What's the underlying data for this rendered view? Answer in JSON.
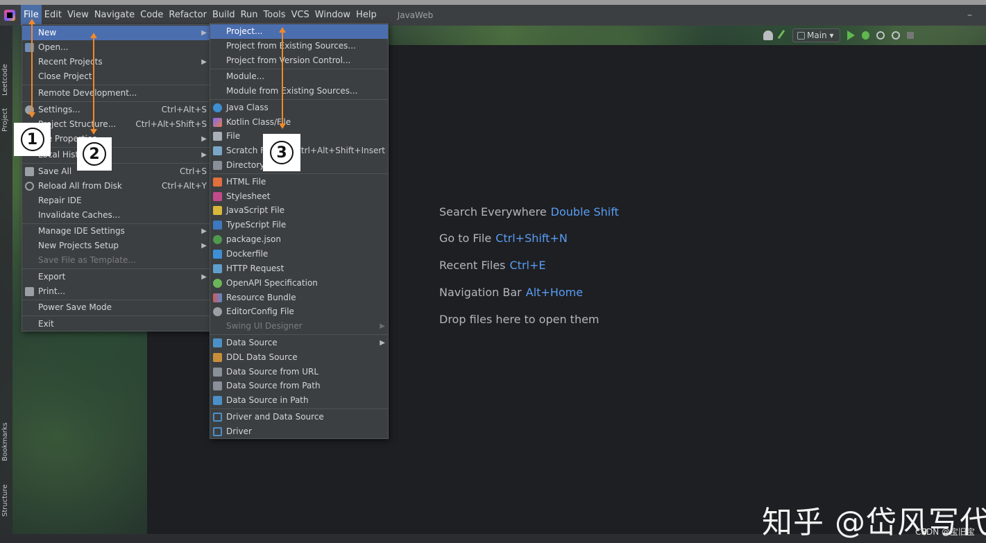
{
  "menubar": {
    "items": [
      "File",
      "Edit",
      "View",
      "Navigate",
      "Code",
      "Refactor",
      "Build",
      "Run",
      "Tools",
      "VCS",
      "Window",
      "Help"
    ],
    "active": "File",
    "title": "JavaWeb",
    "minimize": "–"
  },
  "toolbar": {
    "branch": "Main",
    "branch_caret": "▾"
  },
  "side_panels": [
    "Leetcode",
    "Project",
    "Bookmarks",
    "Structure"
  ],
  "file_menu": {
    "new": "New",
    "open": "Open...",
    "recent_projects": "Recent Projects",
    "close_project": "Close Project",
    "remote_development": "Remote Development...",
    "settings": "Settings...",
    "settings_shortcut": "Ctrl+Alt+S",
    "project_structure": "Project Structure...",
    "project_structure_shortcut": "Ctrl+Alt+Shift+S",
    "file_properties": "File Properties",
    "local_history": "Local History",
    "save_all": "Save All",
    "save_all_shortcut": "Ctrl+S",
    "reload": "Reload All from Disk",
    "reload_shortcut": "Ctrl+Alt+Y",
    "repair_ide": "Repair IDE",
    "invalidate_caches": "Invalidate Caches...",
    "manage_ide_settings": "Manage IDE Settings",
    "new_projects_setup": "New Projects Setup",
    "save_file_as_template": "Save File as Template...",
    "export": "Export",
    "print": "Print...",
    "power_save_mode": "Power Save Mode",
    "exit": "Exit"
  },
  "new_menu": {
    "project": "Project...",
    "project_from_existing": "Project from Existing Sources...",
    "project_from_vcs": "Project from Version Control...",
    "module": "Module...",
    "module_from_existing": "Module from Existing Sources...",
    "java_class": "Java Class",
    "kotlin_class": "Kotlin Class/File",
    "file": "File",
    "scratch_file": "Scratch File",
    "scratch_shortcut": "Ctrl+Alt+Shift+Insert",
    "directory": "Directory",
    "html_file": "HTML File",
    "stylesheet": "Stylesheet",
    "javascript_file": "JavaScript File",
    "typescript_file": "TypeScript File",
    "package_json": "package.json",
    "dockerfile": "Dockerfile",
    "http_request": "HTTP Request",
    "openapi": "OpenAPI Specification",
    "resource_bundle": "Resource Bundle",
    "editorconfig": "EditorConfig File",
    "swing_ui_designer": "Swing UI Designer",
    "data_source": "Data Source",
    "ddl_data_source": "DDL Data Source",
    "data_source_url": "Data Source from URL",
    "data_source_path": "Data Source from Path",
    "data_source_in_path": "Data Source in Path",
    "driver_and_data_source": "Driver and Data Source",
    "driver": "Driver"
  },
  "welcome": {
    "search_label": "Search Everywhere",
    "search_key": "Double Shift",
    "goto_label": "Go to File",
    "goto_key": "Ctrl+Shift+N",
    "recent_label": "Recent Files",
    "recent_key": "Ctrl+E",
    "nav_label": "Navigation Bar",
    "nav_key": "Alt+Home",
    "drop_label": "Drop files here to open them"
  },
  "annotations": {
    "one": "1",
    "two": "2",
    "three": "3"
  },
  "watermark": "知乎 @岱风写代",
  "credit": "CSDN @宝旧宝"
}
